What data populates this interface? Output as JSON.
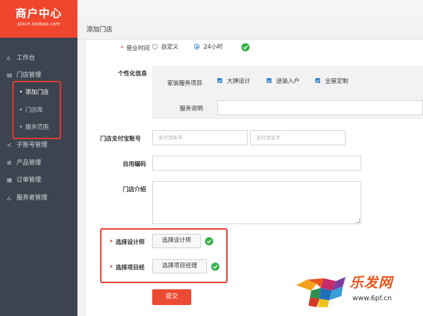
{
  "brand": {
    "name_cn": "商户中心",
    "domain": "place.taobao.com"
  },
  "sidebar": {
    "items": [
      {
        "label": "工作台",
        "icon": "home-icon"
      },
      {
        "label": "门店管理",
        "icon": "store-icon"
      },
      {
        "label": "子账号管理",
        "icon": "share-icon"
      },
      {
        "label": "产品管理",
        "icon": "grid-icon"
      },
      {
        "label": "订单管理",
        "icon": "list-icon"
      },
      {
        "label": "服务者管理",
        "icon": "user-icon"
      }
    ],
    "store_sub": [
      {
        "label": "添加门店",
        "active": true
      },
      {
        "label": "门店库",
        "active": false
      },
      {
        "label": "服务范围",
        "active": false
      }
    ]
  },
  "header": {
    "title": "添加门店"
  },
  "form": {
    "business_hours": {
      "label": "营业时间",
      "options": [
        "自定义",
        "24小时"
      ],
      "selected": "24小时"
    },
    "personalization": {
      "label": "个性化信息",
      "home_service_label": "家装服务项目",
      "services": [
        "大牌设计",
        "送装入户",
        "全屋定制"
      ],
      "service_desc_label": "服务说明",
      "service_desc_value": ""
    },
    "alipay": {
      "label": "门店支付宝账号",
      "account_placeholder": "支付宝账号",
      "name_placeholder": "支付宝名字"
    },
    "own_code": {
      "label": "自用编码",
      "value": ""
    },
    "intro": {
      "label": "门店介绍",
      "value": ""
    },
    "designer": {
      "label": "选择设计师",
      "button": "选择设计师"
    },
    "project_manager": {
      "label": "选择项目经",
      "button": "选择项目经理"
    },
    "submit_label": "提交"
  },
  "watermark": {
    "text": "乐发网",
    "url": "www.6pf.cn"
  },
  "colors": {
    "sidebar_bg": "#3d4450",
    "logo_bg": "#f0462d",
    "primary": "#ec4b33",
    "highlight_border": "#e33b2e",
    "success": "#36b34a",
    "checkbox": "#2f7fd1"
  }
}
